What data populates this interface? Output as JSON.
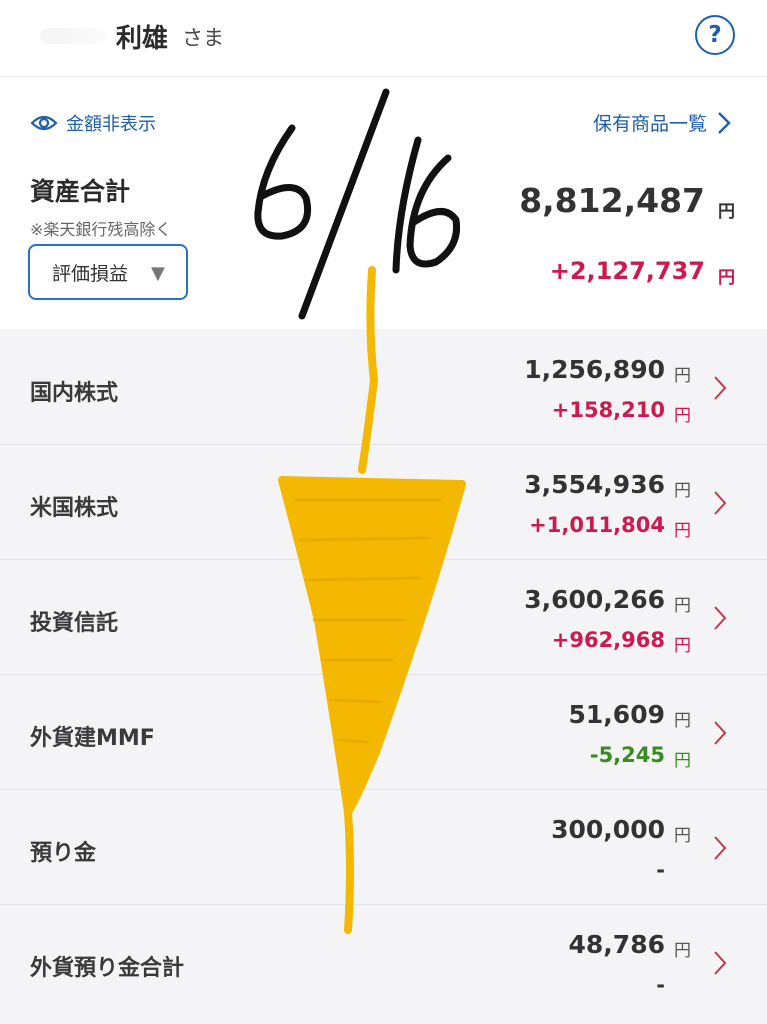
{
  "header": {
    "user_name": "利雄",
    "honorific": "さま",
    "help_icon": "question-circle-icon"
  },
  "summary": {
    "hide_amount_label": "金額非表示",
    "holdings_link_label": "保有商品一覧",
    "total_title": "資産合計",
    "total_note": "※楽天銀行残高除く",
    "total_value": "8,812,487",
    "unit": "円",
    "mode_selected": "評価損益",
    "total_gain": "+2,127,737"
  },
  "rows": [
    {
      "label": "国内株式",
      "value": "1,256,890",
      "gain": "+158,210",
      "gain_color": "#cc1a4e"
    },
    {
      "label": "米国株式",
      "value": "3,554,936",
      "gain": "+1,011,804",
      "gain_color": "#cc1a4e"
    },
    {
      "label": "投資信託",
      "value": "3,600,266",
      "gain": "+962,968",
      "gain_color": "#cc1a4e"
    },
    {
      "label": "外貨建MMF",
      "value": "51,609",
      "gain": "-5,245",
      "gain_color": "#3a8a1e"
    },
    {
      "label": "預り金",
      "value": "300,000",
      "gain": "-",
      "gain_color": "#333333"
    },
    {
      "label": "外貨預り金合計",
      "value": "48,786",
      "gain": "-",
      "gain_color": "#333333"
    }
  ],
  "annotation": {
    "handwritten_text": "6/16",
    "ink_color": "#111111",
    "marker_color": "#f5b800"
  },
  "colors": {
    "accent": "#1f5fa8",
    "gain_positive": "#cc1a4e",
    "gain_negative": "#3a8a1e",
    "chevron": "#c0394b"
  }
}
